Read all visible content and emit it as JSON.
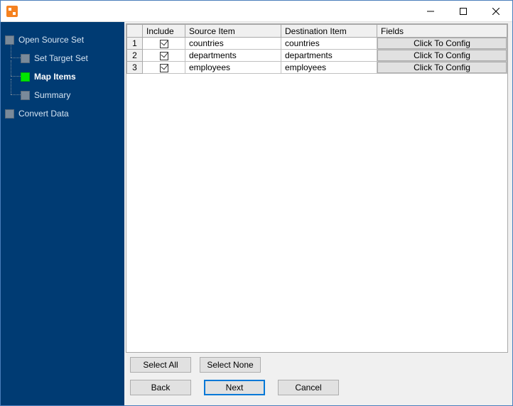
{
  "titlebar": {
    "title": ""
  },
  "sidebar": {
    "items": [
      {
        "label": "Open Source Set",
        "active": false
      },
      {
        "label": "Set Target Set",
        "active": false
      },
      {
        "label": "Map Items",
        "active": true
      },
      {
        "label": "Summary",
        "active": false
      },
      {
        "label": "Convert Data",
        "active": false
      }
    ]
  },
  "grid": {
    "headers": {
      "rownum": "",
      "include": "Include",
      "source": "Source Item",
      "destination": "Destination Item",
      "fields": "Fields"
    },
    "config_label": "Click To Config",
    "rows": [
      {
        "num": "1",
        "include": true,
        "source": "countries",
        "destination": "countries"
      },
      {
        "num": "2",
        "include": true,
        "source": "departments",
        "destination": "departments"
      },
      {
        "num": "3",
        "include": true,
        "source": "employees",
        "destination": "employees"
      }
    ]
  },
  "buttons": {
    "select_all": "Select All",
    "select_none": "Select None",
    "back": "Back",
    "next": "Next",
    "cancel": "Cancel"
  }
}
